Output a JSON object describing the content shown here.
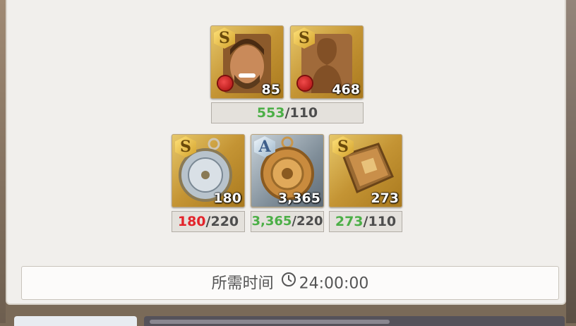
{
  "heroes": [
    {
      "rank": "S",
      "count": "85",
      "type": "hero-portrait"
    },
    {
      "rank": "S",
      "count": "468",
      "type": "hero-silhouette"
    }
  ],
  "hero_requirement": {
    "have": "553",
    "need": "/110"
  },
  "materials": [
    {
      "rank": "S",
      "count": "180",
      "have": "180",
      "need": "/220",
      "status": "insufficient"
    },
    {
      "rank": "A",
      "count": "3,365",
      "have": "3,365",
      "need": "/220",
      "status": "sufficient"
    },
    {
      "rank": "S",
      "count": "273",
      "have": "273",
      "need": "/110",
      "status": "sufficient"
    }
  ],
  "time": {
    "label": "所需时间",
    "value": "24:00:00",
    "icon": "clock-icon"
  },
  "colors": {
    "sufficient": "#4caf47",
    "insufficient": "#e3242b"
  }
}
